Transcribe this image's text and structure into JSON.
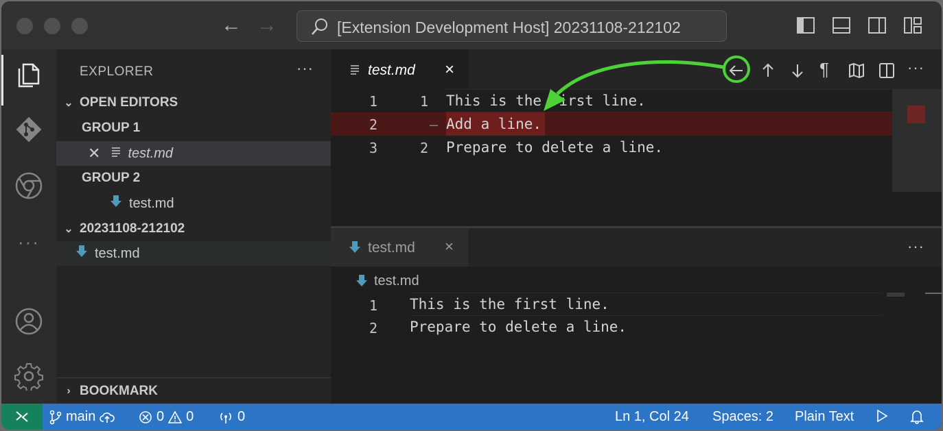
{
  "titlebar": {
    "search_text": "[Extension Development Host] 20231108-212102"
  },
  "sidebar": {
    "title": "EXPLORER",
    "more": "···",
    "open_editors_label": "OPEN EDITORS",
    "group1_label": "GROUP 1",
    "group1_file": "test.md",
    "group2_label": "GROUP 2",
    "group2_file": "test.md",
    "folder_label": "20231108-212102",
    "folder_file": "test.md",
    "bookmark_label": "BOOKMARK"
  },
  "editor1": {
    "tab_label": "test.md",
    "tab_close": "×",
    "more": "···",
    "lines": [
      {
        "orig": "1",
        "mod": "1",
        "marker": "",
        "text": "This is the first line.",
        "removed": false
      },
      {
        "orig": "2",
        "mod": "",
        "marker": "—",
        "text": "Add a line.",
        "removed": true
      },
      {
        "orig": "3",
        "mod": "2",
        "marker": "",
        "text": "Prepare to delete a line.",
        "removed": false
      }
    ]
  },
  "editor2": {
    "tab_label": "test.md",
    "tab_close": "×",
    "more": "···",
    "breadcrumb": "test.md",
    "lines": [
      {
        "num": "1",
        "text": "This is the first line."
      },
      {
        "num": "2",
        "text": "Prepare to delete a line."
      }
    ]
  },
  "statusbar": {
    "branch": "main",
    "errors": "0",
    "warnings": "0",
    "ports": "0",
    "cursor": "Ln 1, Col 24",
    "spaces": "Spaces: 2",
    "language": "Plain Text"
  },
  "colors": {
    "status_bg": "#2b74c6",
    "remote_bg": "#16825d",
    "removed_line": "#4b1818",
    "annotation_green": "#4cd137"
  }
}
